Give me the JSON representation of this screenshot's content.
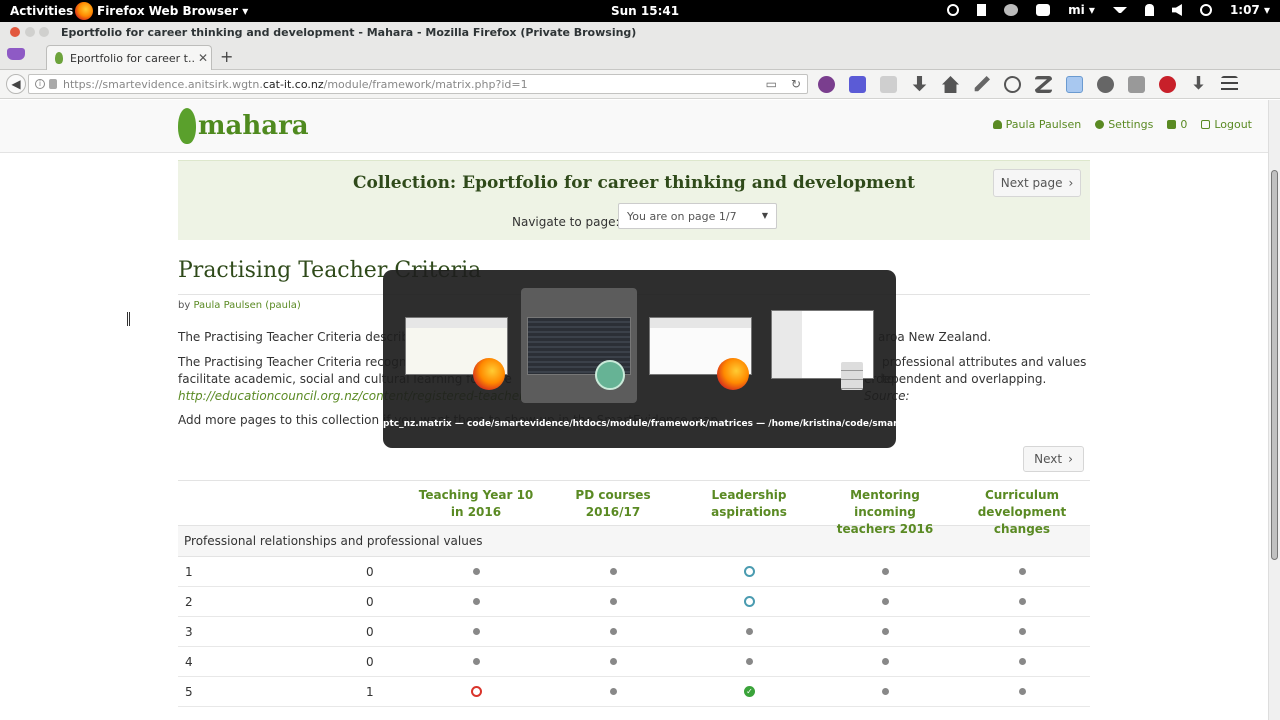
{
  "topbar": {
    "activities": "Activities",
    "app_menu": "Firefox Web Browser ▾",
    "clock": "Sun 15:41",
    "user": "mi ▾",
    "battery_time": "1:07 ▾"
  },
  "window": {
    "title": "Eportfolio for career thinking and development - Mahara - Mozilla Firefox (Private Browsing)"
  },
  "tab": {
    "label": "Eportfolio for career t...",
    "close": "✕",
    "new_tab": "+"
  },
  "url": {
    "prefix": "https://smartevidence.anitsirk.wgtn.",
    "domain": "cat-it.co.nz",
    "suffix": "/module/framework/matrix.php?id=1"
  },
  "site": {
    "logo_text": "mahara",
    "user_name": "Paula Paulsen",
    "settings": "Settings",
    "inbox_count": "0",
    "logout": "Logout"
  },
  "collection": {
    "title": "Collection: Eportfolio for career thinking and development",
    "next_page": "Next page",
    "navigate_label": "Navigate to page:",
    "page_select": "You are on page 1/7"
  },
  "page": {
    "title": "Practising Teacher Criteria",
    "by": "by",
    "author": "Paula Paulsen (paula)",
    "p1_left": "The Practising Teacher Criteria describe th",
    "p1_right": "aroa New Zealand.",
    "p2_left": "The Practising Teacher Criteria recognise t",
    "p2_right": "professional attributes and values to",
    "p2b_left": "facilitate academic, social and cultural learning for dive",
    "p2b_right": "erdependent and overlapping.",
    "source_label": "Source:",
    "source_link": "http://educationcouncil.org.nz/content/registered-teacher-criteria-1",
    "p3": "Add more pages to this collection if you want them to show up in the SmartEvidence map.",
    "next": "Next"
  },
  "matrix": {
    "columns": [
      "Teaching Year 10 in 2016",
      "PD courses 2016/17",
      "Leadership aspirations",
      "Mentoring incoming teachers 2016",
      "Curriculum development changes"
    ],
    "group": "Professional relationships and professional values",
    "rows": [
      {
        "label": "1",
        "count": "0",
        "cells": [
          "dot",
          "dot",
          "ring-blue",
          "dot",
          "dot"
        ]
      },
      {
        "label": "2",
        "count": "0",
        "cells": [
          "dot",
          "dot",
          "ring-blue",
          "dot",
          "dot"
        ]
      },
      {
        "label": "3",
        "count": "0",
        "cells": [
          "dot",
          "dot",
          "dot",
          "dot",
          "dot"
        ]
      },
      {
        "label": "4",
        "count": "0",
        "cells": [
          "dot",
          "dot",
          "dot",
          "dot",
          "dot"
        ]
      },
      {
        "label": "5",
        "count": "1",
        "cells": [
          "ring-red",
          "dot",
          "check-green",
          "dot",
          "dot"
        ]
      }
    ]
  },
  "switcher": {
    "label": "ptc_nz.matrix — code/smartevidence/htdocs/module/framework/matrices — /home/kristina/code/smartevi..."
  },
  "colors": {
    "accent": "#5a8a23",
    "ring_blue": "#4a9bb0",
    "ring_red": "#d9342b",
    "check_green": "#3aa33a"
  }
}
